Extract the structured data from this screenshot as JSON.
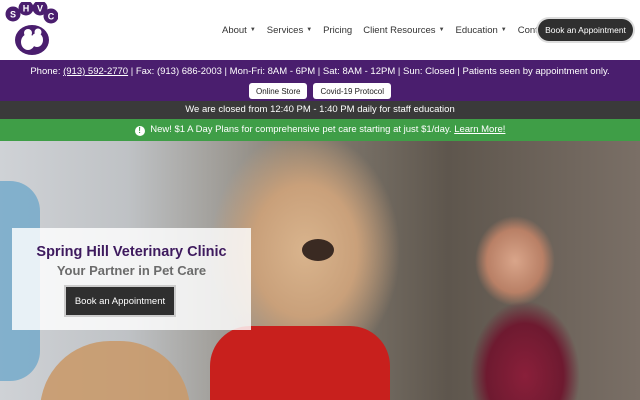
{
  "logo": {
    "letters": [
      "S",
      "H",
      "V",
      "C"
    ]
  },
  "nav": {
    "items": [
      {
        "label": "About",
        "has_dropdown": true
      },
      {
        "label": "Services",
        "has_dropdown": true
      },
      {
        "label": "Pricing",
        "has_dropdown": false
      },
      {
        "label": "Client Resources",
        "has_dropdown": true
      },
      {
        "label": "Education",
        "has_dropdown": true
      },
      {
        "label": "Contact",
        "has_dropdown": false
      }
    ],
    "book_label": "Book an Appointment"
  },
  "info_bar": {
    "phone_label": "Phone:",
    "phone": "(913) 592-2770",
    "rest": "| Fax: (913) 686-2003 | Mon-Fri: 8AM - 6PM | Sat: 8AM - 12PM | Sun: Closed | Patients seen by appointment only.",
    "buttons": [
      "Online Store",
      "Covid-19 Protocol"
    ]
  },
  "closed_notice": "We are closed from 12:40 PM - 1:40 PM daily for staff education",
  "promo": {
    "text": "New! $1 A Day Plans for comprehensive pet care starting at just $1/day.",
    "link": "Learn More!"
  },
  "hero": {
    "title": "Spring Hill Veterinary Clinic",
    "subtitle": "Your Partner in Pet Care",
    "button": "Book an Appointment"
  },
  "colors": {
    "purple": "#4a1e6e",
    "green": "#3f9e47",
    "dark": "#3a3a3a"
  }
}
